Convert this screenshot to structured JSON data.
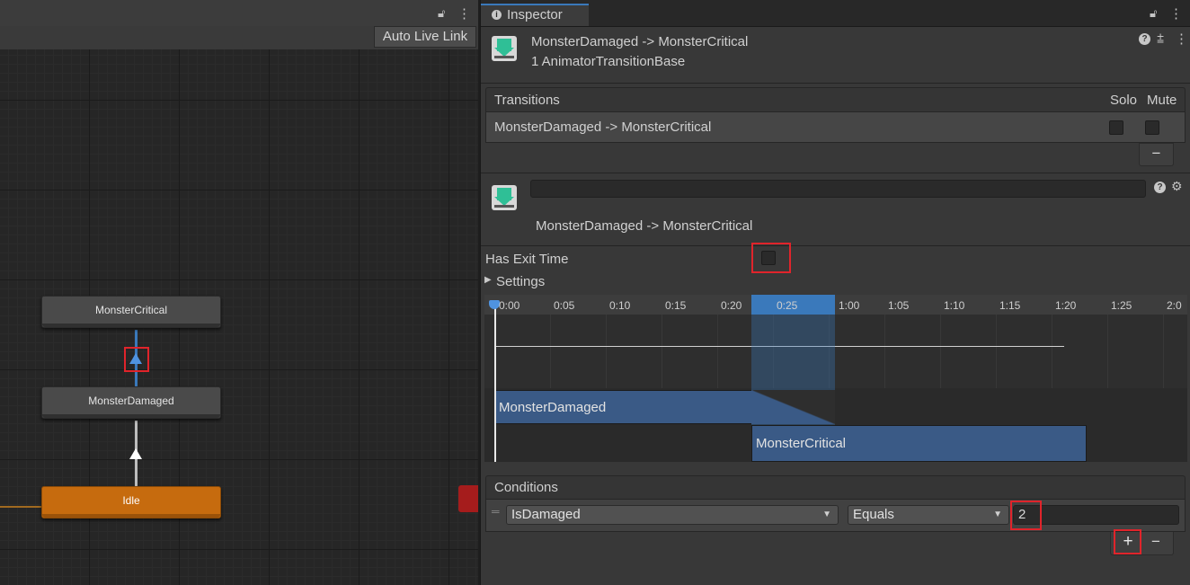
{
  "animator": {
    "toolbar_button": "Auto Live Link",
    "nodes": {
      "critical": "MonsterCritical",
      "damaged": "MonsterDamaged",
      "idle": "Idle"
    }
  },
  "inspector": {
    "tab_label": "Inspector",
    "header_title": "MonsterDamaged -> MonsterCritical",
    "header_subtitle": "1 AnimatorTransitionBase",
    "transitions": {
      "header": "Transitions",
      "solo": "Solo",
      "mute": "Mute",
      "row": "MonsterDamaged -> MonsterCritical",
      "remove": "−"
    },
    "transition_name": "MonsterDamaged -> MonsterCritical",
    "name_field": "",
    "has_exit_time_label": "Has Exit Time",
    "settings_label": "Settings",
    "timeline": {
      "ticks": [
        "0:00",
        "0:05",
        "0:10",
        "0:15",
        "0:20",
        "0:25",
        "1:00",
        "1:05",
        "1:10",
        "1:15",
        "1:20",
        "1:25",
        "2:0"
      ],
      "clip_from": "MonsterDamaged",
      "clip_to": "MonsterCritical"
    },
    "conditions": {
      "header": "Conditions",
      "parameter": "IsDamaged",
      "operator": "Equals",
      "value": "2",
      "add": "+",
      "remove": "−"
    }
  },
  "colors": {
    "accent": "#3a79bb",
    "idle_node": "#c66b0e",
    "highlight_box": "#e0242b"
  }
}
